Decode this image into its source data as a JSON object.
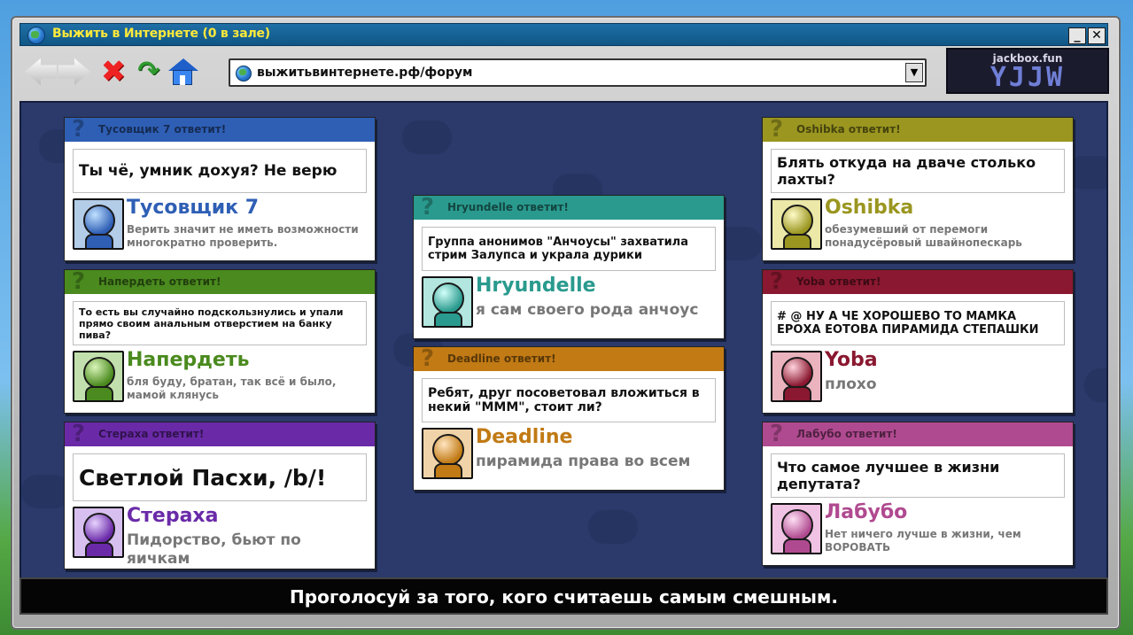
{
  "window": {
    "title": "Выжить в Интернете  (0 в зале)",
    "minimize_label": "_",
    "close_label": "✕"
  },
  "toolbar": {
    "back_icon": "back-arrow-icon",
    "forward_icon": "forward-arrow-icon",
    "stop_label": "✖",
    "refresh_label": "↷",
    "home_icon": "home-icon"
  },
  "address": {
    "url": "выжитьвинтернете.рф/форум",
    "dropdown_label": "▼"
  },
  "room": {
    "site": "jackbox.fun",
    "code": "YJJW"
  },
  "posts": [
    {
      "header": "Тусовщик 7 ответит!",
      "color": "#2f5fb5",
      "prompt": "Ты чё, умник дохуя? Не верю",
      "author": "Тусовщик 7",
      "answer": "Верить  значит не иметь возможности многократно проверить."
    },
    {
      "header": "Напердеть ответит!",
      "color": "#4a8a1e",
      "prompt": "То есть вы случайно подскользнулись и упали прямо своим анальным отверстием на банку пива?",
      "author": "Напердеть",
      "answer": "бля буду, братан, так всё и было, мамой клянусь"
    },
    {
      "header": "Стераха ответит!",
      "color": "#6a2aa8",
      "prompt": "Светлой Пасхи, /b/!",
      "author": "Стераха",
      "answer": "Пидорство, бьют по яичкам"
    },
    {
      "header": "Hryundelle ответит!",
      "color": "#2a9a8e",
      "prompt": "Группа анонимов \"Анчоусы\" захватила стрим Залупса и украла дурики",
      "author": "Hryundelle",
      "answer": "я сам своего рода анчоус"
    },
    {
      "header": "Deadline ответит!",
      "color": "#c17a14",
      "prompt": "Ребят, друг посоветовал вложиться в некий \"МММ\", стоит ли?",
      "author": "Deadline",
      "answer": "пирамида права во всем"
    },
    {
      "header": "Oshibka ответит!",
      "color": "#9a9620",
      "prompt": "Блять откуда на дваче столько лахты?",
      "author": "Oshibka",
      "answer": "обезумевший от перемоги понадусёровый швайнопескарь"
    },
    {
      "header": "Yoba ответит!",
      "color": "#8a1830",
      "prompt": "# @ НУ А ЧЕ ХОРОШЕВО ТО МАМКА ЕРОХА ЕОТОВА ПИРАМИДА СТЕПАШКИ",
      "author": "Yoba",
      "answer": "плохо"
    },
    {
      "header": "Лабубо ответит!",
      "color": "#b04a90",
      "prompt": "Что самое лучшее в жизни депутата?",
      "author": "Лабубо",
      "answer": "Нет ничего лучше в жизни, чем ВОРОВАТЬ"
    }
  ],
  "footer": {
    "instruction": "Проголосуй за того, кого считаешь самым смешным."
  }
}
